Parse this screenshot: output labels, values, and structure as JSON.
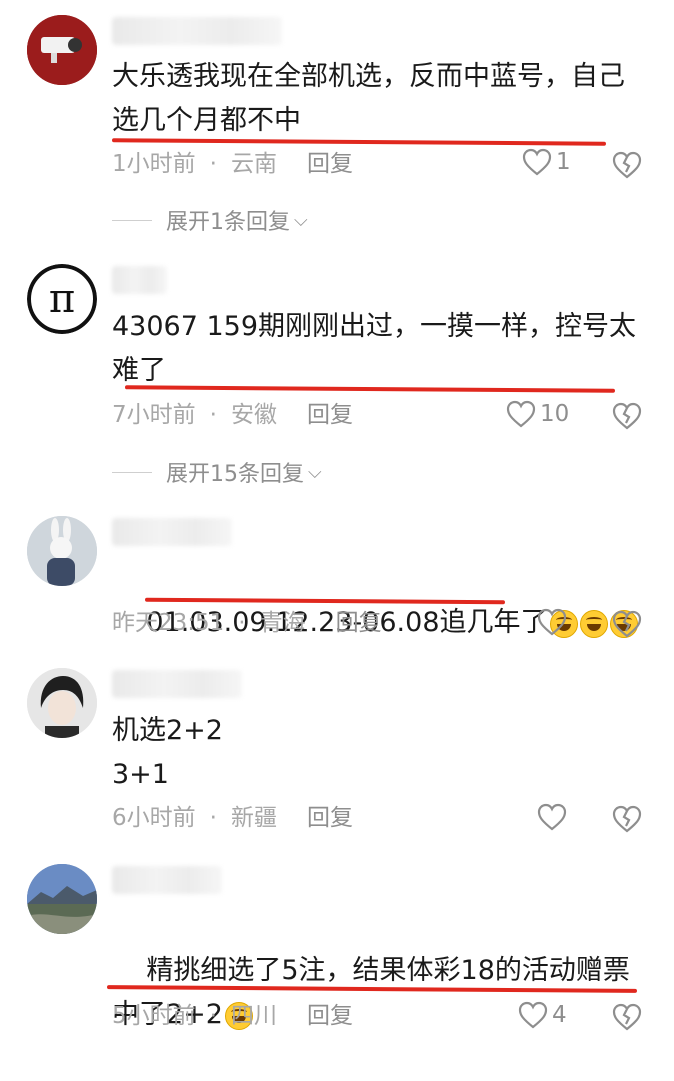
{
  "comments": [
    {
      "text": "大乐透我现在全部机选，反而中蓝号，自己选几个月都不中",
      "time": "1小时前",
      "location": "云南",
      "reply": "回复",
      "likes": "1",
      "expand": "展开1条回复",
      "avatar_icon": "camera-avatar-icon"
    },
    {
      "text": "43067 159期刚刚出过，一摸一样，控号太难了",
      "time": "7小时前",
      "location": "安徽",
      "reply": "回复",
      "likes": "10",
      "expand": "展开15条回复",
      "avatar_icon": "pi-avatar-icon"
    },
    {
      "text": "01.03.09.12.23-06.08追几年了",
      "time": "昨天23:51",
      "location": "青海",
      "reply": "回复",
      "likes": "",
      "avatar_icon": "rabbit-avatar-icon"
    },
    {
      "text": "机选2+2\n3+1",
      "time": "6小时前",
      "location": "新疆",
      "reply": "回复",
      "likes": "",
      "avatar_icon": "person-avatar-icon"
    },
    {
      "text": "精挑细选了5注，结果体彩18的活动赠票中了2+2",
      "time": "5小时前",
      "location": "四川",
      "reply": "回复",
      "likes": "4",
      "avatar_icon": "landscape-avatar-icon"
    }
  ],
  "colors": {
    "underline": "#e0281e",
    "meta": "#a7a7a7",
    "text": "#1a1a1a"
  }
}
